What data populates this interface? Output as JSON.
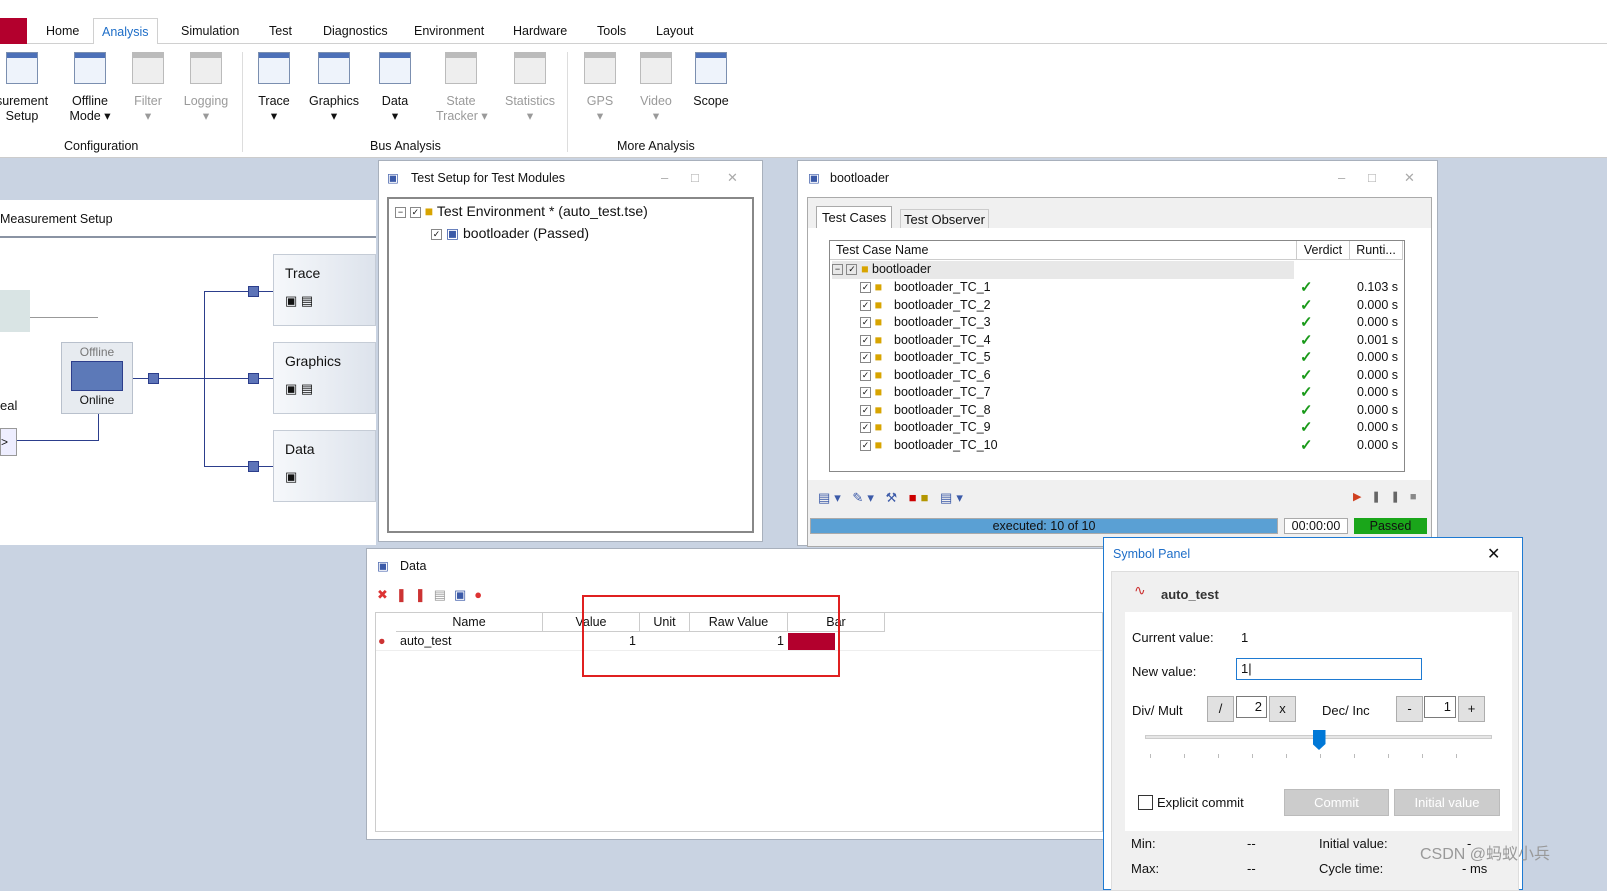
{
  "ribbon": {
    "tabs": [
      "Home",
      "Analysis",
      "Simulation",
      "Test",
      "Diagnostics",
      "Environment",
      "Hardware",
      "Tools",
      "Layout"
    ],
    "active_tab": "Analysis",
    "buttons": [
      {
        "label": "surement\nSetup",
        "icon": "measurement-setup-icon"
      },
      {
        "label": "Offline\nMode ▾",
        "icon": "offline-mode-icon"
      },
      {
        "label": "Filter\n▾",
        "icon": "filter-icon",
        "disabled": true
      },
      {
        "label": "Logging\n▾",
        "icon": "logging-icon",
        "disabled": true
      },
      {
        "label": "Trace\n▾",
        "icon": "trace-icon"
      },
      {
        "label": "Graphics\n▾",
        "icon": "graphics-icon"
      },
      {
        "label": "Data\n▾",
        "icon": "data-icon"
      },
      {
        "label": "State\nTracker ▾",
        "icon": "state-tracker-icon",
        "disabled": true
      },
      {
        "label": "Statistics\n▾",
        "icon": "statistics-icon",
        "disabled": true
      },
      {
        "label": "GPS\n▾",
        "icon": "gps-icon",
        "disabled": true
      },
      {
        "label": "Video\n▾",
        "icon": "video-icon",
        "disabled": true
      },
      {
        "label": "Scope",
        "icon": "scope-icon"
      }
    ],
    "groups": [
      "Configuration",
      "Bus Analysis",
      "More Analysis"
    ]
  },
  "measurement": {
    "title": "Measurement Setup",
    "offline": "Offline",
    "online": "Online",
    "real": "eal",
    "nodes": [
      "Trace",
      "Graphics",
      "Data"
    ]
  },
  "test_setup": {
    "title": "Test Setup for Test Modules",
    "env": "Test Environment *  (auto_test.tse)",
    "module": "bootloader (Passed)"
  },
  "bootloader": {
    "title": "bootloader",
    "tabs": [
      "Test Cases",
      "Test Observer"
    ],
    "columns": [
      "Test Case Name",
      "Verdict",
      "Runti..."
    ],
    "root": "bootloader",
    "rows": [
      {
        "name": "bootloader_TC_1",
        "verdict": "✓",
        "time": "0.103 s"
      },
      {
        "name": "bootloader_TC_2",
        "verdict": "✓",
        "time": "0.000 s"
      },
      {
        "name": "bootloader_TC_3",
        "verdict": "✓",
        "time": "0.000 s"
      },
      {
        "name": "bootloader_TC_4",
        "verdict": "✓",
        "time": "0.001 s"
      },
      {
        "name": "bootloader_TC_5",
        "verdict": "✓",
        "time": "0.000 s"
      },
      {
        "name": "bootloader_TC_6",
        "verdict": "✓",
        "time": "0.000 s"
      },
      {
        "name": "bootloader_TC_7",
        "verdict": "✓",
        "time": "0.000 s"
      },
      {
        "name": "bootloader_TC_8",
        "verdict": "✓",
        "time": "0.000 s"
      },
      {
        "name": "bootloader_TC_9",
        "verdict": "✓",
        "time": "0.000 s"
      },
      {
        "name": "bootloader_TC_10",
        "verdict": "✓",
        "time": "0.000 s"
      }
    ],
    "progress_text": "executed: 10 of 10",
    "progress": 1.0,
    "elapsed": "00:00:00",
    "status": "Passed",
    "status_color": "#1aa61a"
  },
  "data_window": {
    "title": "Data",
    "columns": [
      "Name",
      "Value",
      "Unit",
      "Raw Value",
      "Bar"
    ],
    "rows": [
      {
        "name": "auto_test",
        "value": "1",
        "unit": "",
        "raw": "1"
      }
    ],
    "bar_color": "#b3002d"
  },
  "symbol_panel": {
    "title": "Symbol Panel",
    "symbol": "auto_test",
    "current_label": "Current value:",
    "current_value": "1",
    "new_label": "New value:",
    "new_value": "1",
    "divmult_label": "Div/ Mult",
    "div_btn": "/",
    "div_value": "2",
    "mult_btn": "x",
    "decinc_label": "Dec/ Inc",
    "dec_btn": "-",
    "inc_value": "1",
    "inc_btn": "+",
    "slider_position": 0.5,
    "explicit_commit": "Explicit commit",
    "commit": "Commit",
    "initial_btn": "Initial value",
    "min_label": "Min:",
    "min_value": "--",
    "max_label": "Max:",
    "max_value": "--",
    "initial_label": "Initial value:",
    "initial_value": "-",
    "cycle_label": "Cycle time:",
    "cycle_value": "- ms"
  },
  "watermark": "CSDN @蚂蚁小兵"
}
